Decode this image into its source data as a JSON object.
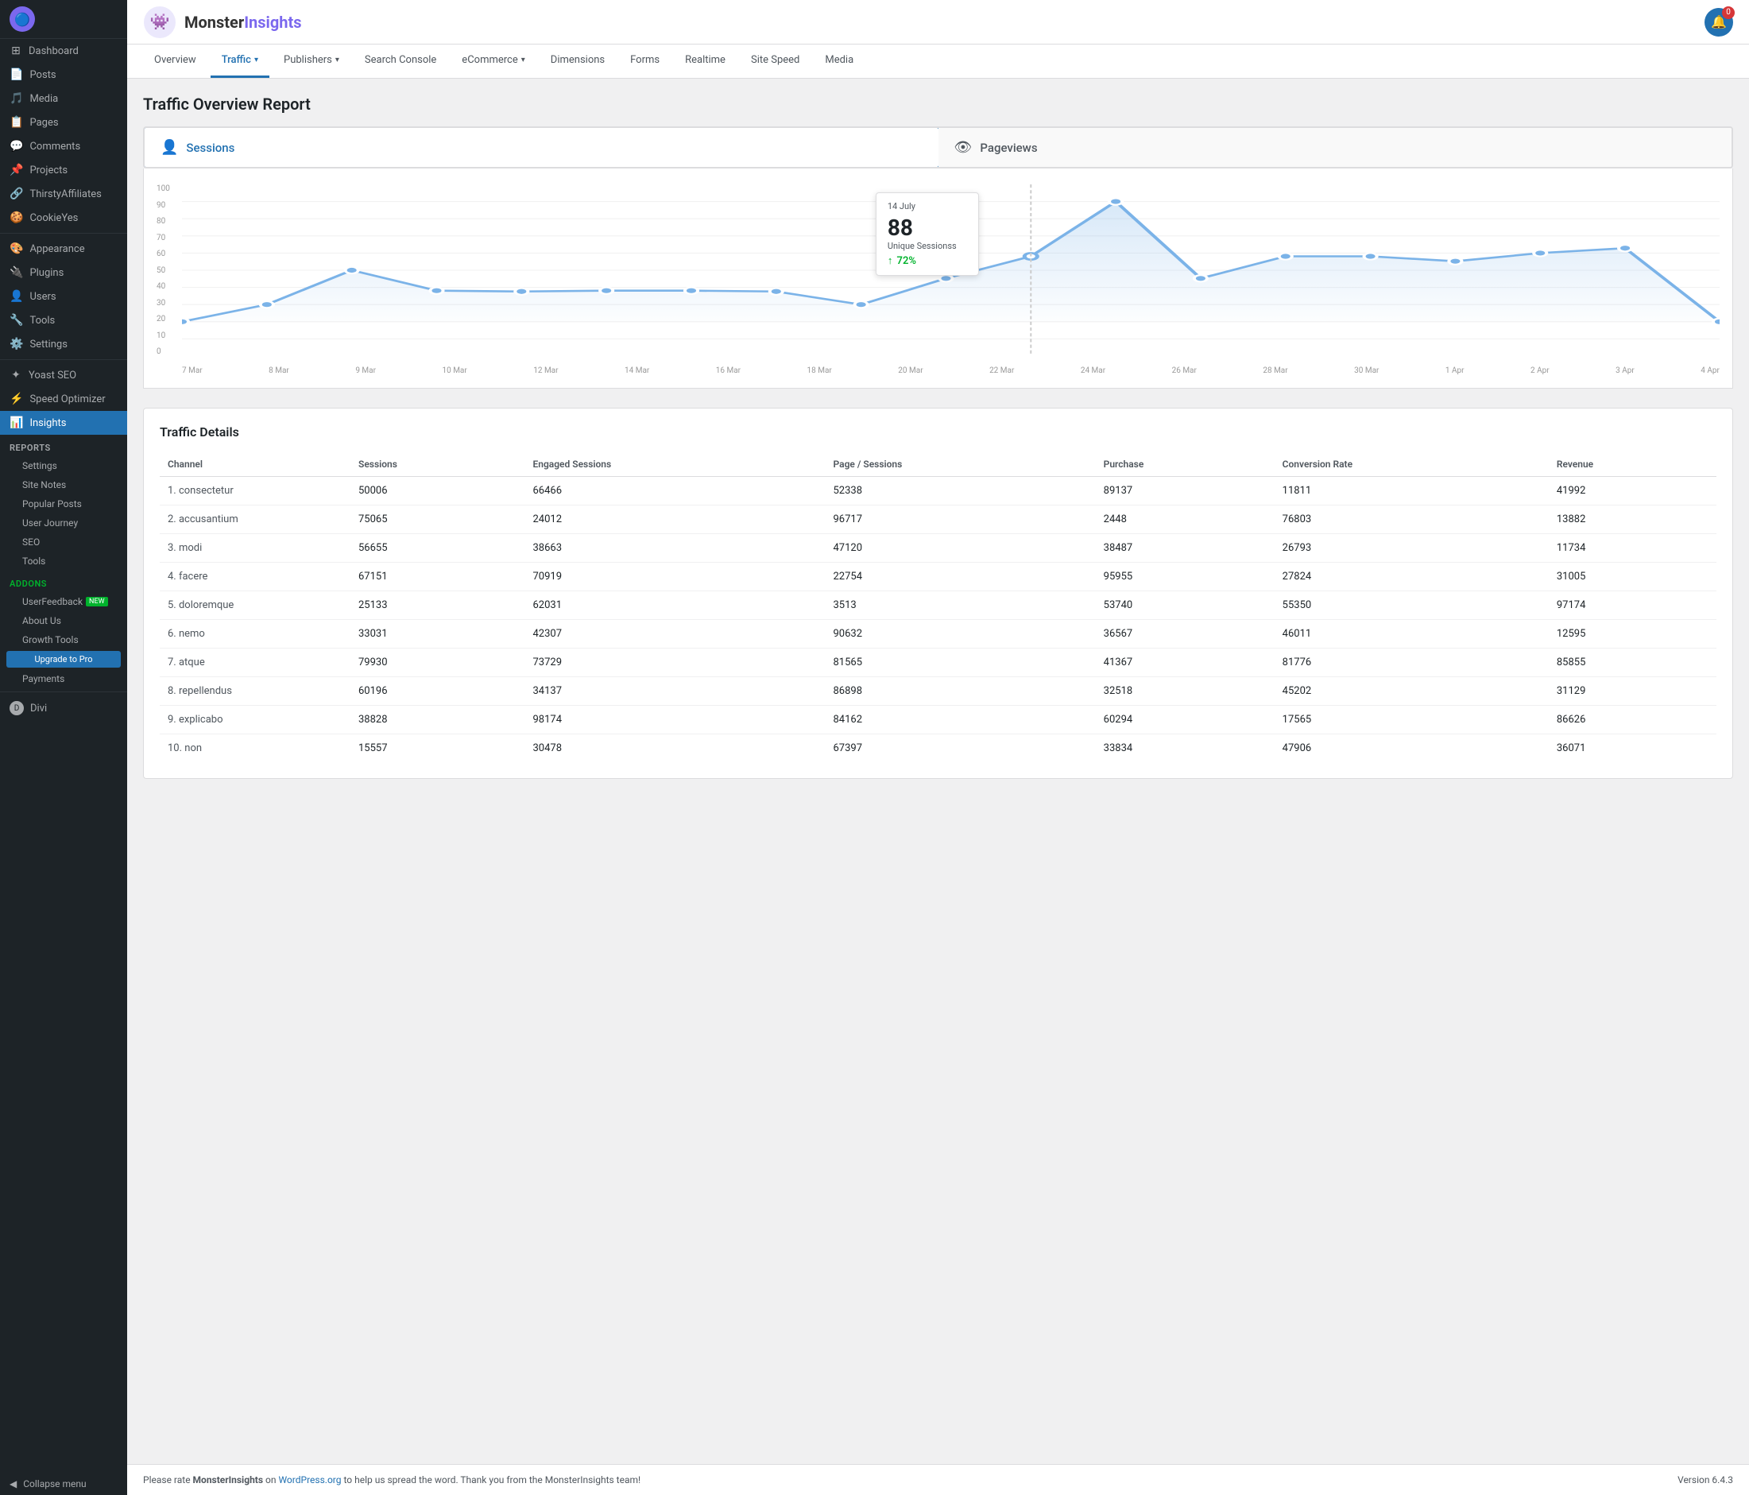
{
  "sidebar": {
    "brand": {
      "icon": "🔵",
      "name": "MonsterInsights"
    },
    "menu_items": [
      {
        "id": "dashboard",
        "label": "Dashboard",
        "icon": "⊞"
      },
      {
        "id": "posts",
        "label": "Posts",
        "icon": "📄"
      },
      {
        "id": "media",
        "label": "Media",
        "icon": "🎵"
      },
      {
        "id": "pages",
        "label": "Pages",
        "icon": "📋"
      },
      {
        "id": "comments",
        "label": "Comments",
        "icon": "💬"
      },
      {
        "id": "projects",
        "label": "Projects",
        "icon": "📌"
      },
      {
        "id": "thirstyaffiliates",
        "label": "ThirstyAffiliates",
        "icon": "🔗"
      },
      {
        "id": "cookieyes",
        "label": "CookieYes",
        "icon": "🍪"
      },
      {
        "id": "appearance",
        "label": "Appearance",
        "icon": "🎨"
      },
      {
        "id": "plugins",
        "label": "Plugins",
        "icon": "🔌"
      },
      {
        "id": "users",
        "label": "Users",
        "icon": "👤"
      },
      {
        "id": "tools",
        "label": "Tools",
        "icon": "🔧"
      },
      {
        "id": "settings",
        "label": "Settings",
        "icon": "⚙️"
      },
      {
        "id": "yoast-seo",
        "label": "Yoast SEO",
        "icon": "✦"
      },
      {
        "id": "speed-optimizer",
        "label": "Speed Optimizer",
        "icon": "⚡"
      },
      {
        "id": "insights",
        "label": "Insights",
        "icon": "📊",
        "active": true
      }
    ],
    "reports_section": {
      "label": "Reports",
      "items": [
        {
          "id": "settings-sub",
          "label": "Settings"
        },
        {
          "id": "site-notes",
          "label": "Site Notes"
        },
        {
          "id": "popular-posts",
          "label": "Popular Posts"
        },
        {
          "id": "user-journey",
          "label": "User Journey"
        },
        {
          "id": "seo",
          "label": "SEO"
        },
        {
          "id": "tools-sub",
          "label": "Tools"
        }
      ]
    },
    "addons_section": {
      "label": "Addons",
      "items": [
        {
          "id": "userfeedback",
          "label": "UserFeedback",
          "badge": "NEW"
        },
        {
          "id": "about-us",
          "label": "About Us"
        },
        {
          "id": "growth-tools",
          "label": "Growth Tools"
        }
      ]
    },
    "upgrade_label": "Upgrade to Pro",
    "payments_label": "Payments",
    "divi_label": "Divi",
    "collapse_label": "Collapse menu"
  },
  "header": {
    "logo_text_1": "Monster",
    "logo_text_2": "Insights",
    "notification_count": "0"
  },
  "nav": {
    "tabs": [
      {
        "id": "overview",
        "label": "Overview",
        "active": false
      },
      {
        "id": "traffic",
        "label": "Traffic",
        "active": true,
        "has_arrow": true
      },
      {
        "id": "publishers",
        "label": "Publishers",
        "active": false,
        "has_arrow": true
      },
      {
        "id": "search-console",
        "label": "Search Console",
        "active": false
      },
      {
        "id": "ecommerce",
        "label": "eCommerce",
        "active": false,
        "has_arrow": true
      },
      {
        "id": "dimensions",
        "label": "Dimensions",
        "active": false
      },
      {
        "id": "forms",
        "label": "Forms",
        "active": false
      },
      {
        "id": "realtime",
        "label": "Realtime",
        "active": false
      },
      {
        "id": "site-speed",
        "label": "Site Speed",
        "active": false
      },
      {
        "id": "media",
        "label": "Media",
        "active": false
      }
    ]
  },
  "page_title": "Traffic Overview Report",
  "metrics": {
    "sessions_label": "Sessions",
    "pageviews_label": "Pageviews"
  },
  "chart": {
    "tooltip": {
      "date": "14 July",
      "value": "88",
      "label": "Unique Sessionss",
      "change": "72%"
    },
    "y_labels": [
      "100",
      "90",
      "80",
      "70",
      "60",
      "50",
      "40",
      "30",
      "20",
      "10",
      "0"
    ],
    "x_labels": [
      "7 Mar",
      "8 Mar",
      "9 Mar",
      "10 Mar",
      "12 Mar",
      "14 Mar",
      "16 Mar",
      "18 Mar",
      "20 Mar",
      "22 Mar",
      "24 Mar",
      "26 Mar",
      "28 Mar",
      "30 Mar",
      "1 Apr",
      "2 Apr",
      "3 Apr",
      "4 Apr"
    ]
  },
  "traffic_details": {
    "title": "Traffic Details",
    "columns": [
      "Channel",
      "Sessions",
      "Engaged Sessions",
      "Page / Sessions",
      "Purchase",
      "Conversion Rate",
      "Revenue"
    ],
    "rows": [
      {
        "rank": "1.",
        "channel": "consectetur",
        "sessions": "50006",
        "engaged": "66466",
        "page_sessions": "52338",
        "purchase": "89137",
        "conversion": "11811",
        "revenue": "41992"
      },
      {
        "rank": "2.",
        "channel": "accusantium",
        "sessions": "75065",
        "engaged": "24012",
        "page_sessions": "96717",
        "purchase": "2448",
        "conversion": "76803",
        "revenue": "13882"
      },
      {
        "rank": "3.",
        "channel": "modi",
        "sessions": "56655",
        "engaged": "38663",
        "page_sessions": "47120",
        "purchase": "38487",
        "conversion": "26793",
        "revenue": "11734"
      },
      {
        "rank": "4.",
        "channel": "facere",
        "sessions": "67151",
        "engaged": "70919",
        "page_sessions": "22754",
        "purchase": "95955",
        "conversion": "27824",
        "revenue": "31005"
      },
      {
        "rank": "5.",
        "channel": "doloremque",
        "sessions": "25133",
        "engaged": "62031",
        "page_sessions": "3513",
        "purchase": "53740",
        "conversion": "55350",
        "revenue": "97174"
      },
      {
        "rank": "6.",
        "channel": "nemo",
        "sessions": "33031",
        "engaged": "42307",
        "page_sessions": "90632",
        "purchase": "36567",
        "conversion": "46011",
        "revenue": "12595"
      },
      {
        "rank": "7.",
        "channel": "atque",
        "sessions": "79930",
        "engaged": "73729",
        "page_sessions": "81565",
        "purchase": "41367",
        "conversion": "81776",
        "revenue": "85855"
      },
      {
        "rank": "8.",
        "channel": "repellendus",
        "sessions": "60196",
        "engaged": "34137",
        "page_sessions": "86898",
        "purchase": "32518",
        "conversion": "45202",
        "revenue": "31129"
      },
      {
        "rank": "9.",
        "channel": "explicabo",
        "sessions": "38828",
        "engaged": "98174",
        "page_sessions": "84162",
        "purchase": "60294",
        "conversion": "17565",
        "revenue": "86626"
      },
      {
        "rank": "10.",
        "channel": "non",
        "sessions": "15557",
        "engaged": "30478",
        "page_sessions": "67397",
        "purchase": "33834",
        "conversion": "47906",
        "revenue": "36071"
      }
    ]
  },
  "footer": {
    "text_prefix": "Please rate ",
    "brand": "MonsterInsights",
    "text_suffix": " on ",
    "link_text": "WordPress.org",
    "text_end": " to help us spread the word. Thank you from the MonsterInsights team!",
    "version": "Version 6.4.3"
  },
  "colors": {
    "accent_blue": "#2271b1",
    "active_sidebar": "#2271b1",
    "sidebar_bg": "#1d2327",
    "chart_line": "#7bb3e8",
    "chart_fill": "rgba(123,179,232,0.15)"
  }
}
